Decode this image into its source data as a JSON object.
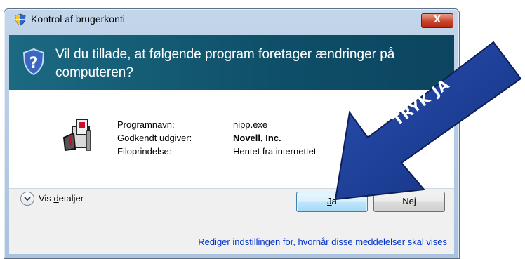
{
  "window": {
    "title": "Kontrol af brugerkonti",
    "close_label": "X"
  },
  "banner": {
    "question": "Vil du tillade, at følgende program foretager ændringer på computeren?"
  },
  "program": {
    "fields": [
      {
        "label": "Programnavn:",
        "value": "nipp.exe"
      },
      {
        "label": "Godkendt udgiver:",
        "value": "Novell, Inc."
      },
      {
        "label": "Filoprindelse:",
        "value": "Hentet fra internettet"
      }
    ]
  },
  "footer": {
    "details_prefix": "Vis ",
    "details_accel": "d",
    "details_rest": "etaljer",
    "yes_accel": "J",
    "yes_rest": "a",
    "no_label": "Nej",
    "settings_link": "Rediger indstillingen for, hvornår disse meddelelser skal vises"
  },
  "annotation": {
    "arrow_text": "TRYK JA",
    "arrow_color": "#1f3f9c"
  },
  "colors": {
    "banner": "#0f4f68",
    "link": "#0033cc",
    "close": "#c8452b"
  }
}
